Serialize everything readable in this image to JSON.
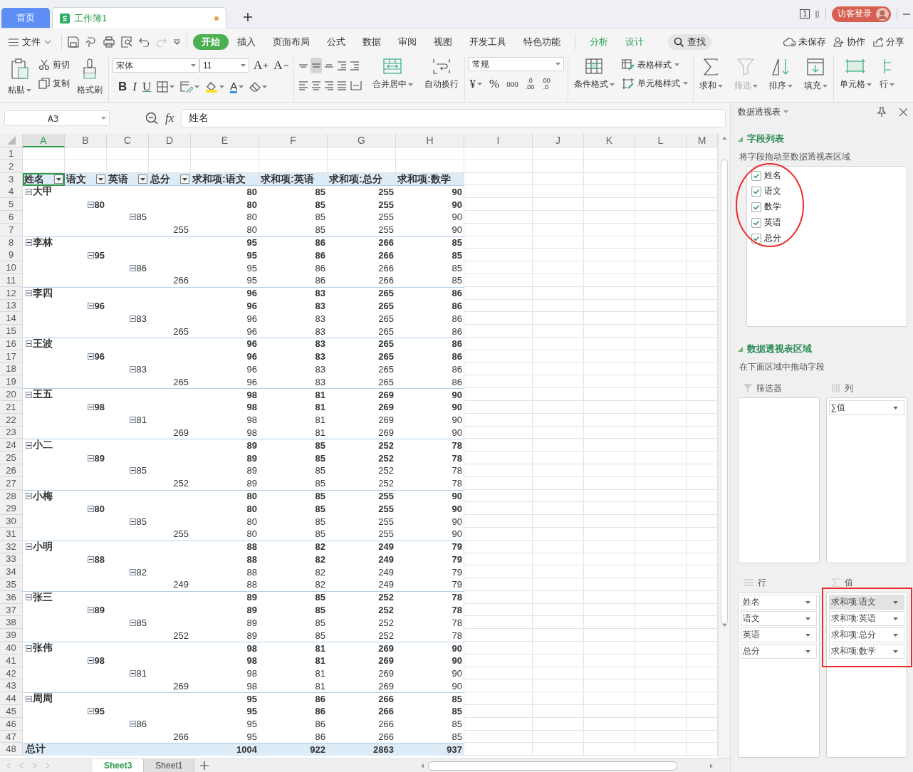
{
  "tabs": [
    {
      "label": "首页",
      "kind": "home",
      "selected": false
    },
    {
      "label": "工作簿1",
      "kind": "workbook",
      "selected": true,
      "unsaved": true
    }
  ],
  "title_bar": {
    "page_count": "1",
    "login_button": "访客登录"
  },
  "menu": {
    "file": "文件",
    "tabs": [
      {
        "label": "开始",
        "kind": "main",
        "selected": true
      },
      {
        "label": "插入",
        "kind": "main",
        "selected": false
      },
      {
        "label": "页面布局",
        "kind": "main",
        "selected": false
      },
      {
        "label": "公式",
        "kind": "main",
        "selected": false
      },
      {
        "label": "数据",
        "kind": "main",
        "selected": false
      },
      {
        "label": "审阅",
        "kind": "main",
        "selected": false
      },
      {
        "label": "视图",
        "kind": "main",
        "selected": false
      },
      {
        "label": "开发工具",
        "kind": "main",
        "selected": false
      },
      {
        "label": "特色功能",
        "kind": "main",
        "selected": false
      },
      {
        "label": "分析",
        "kind": "context",
        "selected": false
      },
      {
        "label": "设计",
        "kind": "context",
        "selected": false
      }
    ],
    "search": "查找",
    "actions": [
      "未保存",
      "协作",
      "分享"
    ]
  },
  "ribbon": {
    "paste": "粘贴",
    "cut": "剪切",
    "copy": "复制",
    "format_painter": "格式刷",
    "font_name": "宋体",
    "font_size": "11",
    "grow_font": "A",
    "shrink_font": "A",
    "bold": "B",
    "italic": "I",
    "underline": "U",
    "font_color": "A",
    "merge_center": "合并居中",
    "wrap_text": "自动换行",
    "number_format": "常规",
    "currency": "¥",
    "percent": "%",
    "thousands": "000",
    "increase_decimal": [
      ".0",
      ".00"
    ],
    "decrease_decimal": [
      ".00",
      ".0"
    ],
    "conditional_format": "条件格式",
    "table_style": "表格样式",
    "cell_style": "单元格样式",
    "sum": "求和",
    "filter": {
      "label": "筛选",
      "disabled": true
    },
    "sort": "排序",
    "fill": "填充",
    "cells": "单元格",
    "rows_columns": "行"
  },
  "formula_bar": {
    "name_box": "A3",
    "fx": "fx",
    "value": "姓名"
  },
  "sheet": {
    "columns": [
      {
        "label": "A",
        "selected": true
      },
      {
        "label": "B",
        "selected": false
      },
      {
        "label": "C",
        "selected": false
      },
      {
        "label": "D",
        "selected": false
      },
      {
        "label": "E",
        "selected": false
      },
      {
        "label": "F",
        "selected": false
      },
      {
        "label": "G",
        "selected": false
      },
      {
        "label": "H",
        "selected": false
      },
      {
        "label": "I",
        "selected": false
      },
      {
        "label": "J",
        "selected": false
      },
      {
        "label": "K",
        "selected": false
      },
      {
        "label": "L",
        "selected": false
      },
      {
        "label": "M",
        "selected": false
      }
    ],
    "row_numbers": [
      "1",
      "2",
      "3",
      "4",
      "5",
      "6",
      "7",
      "8",
      "9",
      "10",
      "11",
      "12",
      "13",
      "14",
      "15",
      "16",
      "17",
      "18",
      "19",
      "20",
      "21",
      "22",
      "23",
      "24",
      "25",
      "26",
      "27",
      "28",
      "29",
      "30",
      "31",
      "32",
      "33",
      "34",
      "35",
      "36",
      "37",
      "38",
      "39",
      "40",
      "41",
      "42",
      "43",
      "44",
      "45",
      "46",
      "47",
      "48"
    ],
    "header": [
      {
        "label": "姓名",
        "filter": true
      },
      {
        "label": "语文",
        "filter": true
      },
      {
        "label": "英语",
        "filter": true
      },
      {
        "label": "总分",
        "filter": true
      },
      {
        "label": "求和项:语文",
        "filter": false
      },
      {
        "label": "求和项:英语",
        "filter": false
      },
      {
        "label": "求和项:总分",
        "filter": false
      },
      {
        "label": "求和项:数学",
        "filter": false
      }
    ]
  },
  "pivot_rows": [
    {
      "kind": "name",
      "label": "大甲",
      "values": [
        "80",
        "85",
        "255",
        "90"
      ]
    },
    {
      "kind": "yuwen",
      "label": "80",
      "values": [
        "80",
        "85",
        "255",
        "90"
      ]
    },
    {
      "kind": "yingyu",
      "label": "85",
      "values": [
        "80",
        "85",
        "255",
        "90"
      ]
    },
    {
      "kind": "zongfen",
      "label": "255",
      "values": [
        "80",
        "85",
        "255",
        "90"
      ]
    },
    {
      "kind": "name",
      "label": "李林",
      "values": [
        "95",
        "86",
        "266",
        "85"
      ]
    },
    {
      "kind": "yuwen",
      "label": "95",
      "values": [
        "95",
        "86",
        "266",
        "85"
      ]
    },
    {
      "kind": "yingyu",
      "label": "86",
      "values": [
        "95",
        "86",
        "266",
        "85"
      ]
    },
    {
      "kind": "zongfen",
      "label": "266",
      "values": [
        "95",
        "86",
        "266",
        "85"
      ]
    },
    {
      "kind": "name",
      "label": "李四",
      "values": [
        "96",
        "83",
        "265",
        "86"
      ]
    },
    {
      "kind": "yuwen",
      "label": "96",
      "values": [
        "96",
        "83",
        "265",
        "86"
      ]
    },
    {
      "kind": "yingyu",
      "label": "83",
      "values": [
        "96",
        "83",
        "265",
        "86"
      ]
    },
    {
      "kind": "zongfen",
      "label": "265",
      "values": [
        "96",
        "83",
        "265",
        "86"
      ]
    },
    {
      "kind": "name",
      "label": "王波",
      "values": [
        "96",
        "83",
        "265",
        "86"
      ]
    },
    {
      "kind": "yuwen",
      "label": "96",
      "values": [
        "96",
        "83",
        "265",
        "86"
      ]
    },
    {
      "kind": "yingyu",
      "label": "83",
      "values": [
        "96",
        "83",
        "265",
        "86"
      ]
    },
    {
      "kind": "zongfen",
      "label": "265",
      "values": [
        "96",
        "83",
        "265",
        "86"
      ]
    },
    {
      "kind": "name",
      "label": "王五",
      "values": [
        "98",
        "81",
        "269",
        "90"
      ]
    },
    {
      "kind": "yuwen",
      "label": "98",
      "values": [
        "98",
        "81",
        "269",
        "90"
      ]
    },
    {
      "kind": "yingyu",
      "label": "81",
      "values": [
        "98",
        "81",
        "269",
        "90"
      ]
    },
    {
      "kind": "zongfen",
      "label": "269",
      "values": [
        "98",
        "81",
        "269",
        "90"
      ]
    },
    {
      "kind": "name",
      "label": "小二",
      "values": [
        "89",
        "85",
        "252",
        "78"
      ]
    },
    {
      "kind": "yuwen",
      "label": "89",
      "values": [
        "89",
        "85",
        "252",
        "78"
      ]
    },
    {
      "kind": "yingyu",
      "label": "85",
      "values": [
        "89",
        "85",
        "252",
        "78"
      ]
    },
    {
      "kind": "zongfen",
      "label": "252",
      "values": [
        "89",
        "85",
        "252",
        "78"
      ]
    },
    {
      "kind": "name",
      "label": "小梅",
      "values": [
        "80",
        "85",
        "255",
        "90"
      ]
    },
    {
      "kind": "yuwen",
      "label": "80",
      "values": [
        "80",
        "85",
        "255",
        "90"
      ]
    },
    {
      "kind": "yingyu",
      "label": "85",
      "values": [
        "80",
        "85",
        "255",
        "90"
      ]
    },
    {
      "kind": "zongfen",
      "label": "255",
      "values": [
        "80",
        "85",
        "255",
        "90"
      ]
    },
    {
      "kind": "name",
      "label": "小明",
      "values": [
        "88",
        "82",
        "249",
        "79"
      ]
    },
    {
      "kind": "yuwen",
      "label": "88",
      "values": [
        "88",
        "82",
        "249",
        "79"
      ]
    },
    {
      "kind": "yingyu",
      "label": "82",
      "values": [
        "88",
        "82",
        "249",
        "79"
      ]
    },
    {
      "kind": "zongfen",
      "label": "249",
      "values": [
        "88",
        "82",
        "249",
        "79"
      ]
    },
    {
      "kind": "name",
      "label": "张三",
      "values": [
        "89",
        "85",
        "252",
        "78"
      ]
    },
    {
      "kind": "yuwen",
      "label": "89",
      "values": [
        "89",
        "85",
        "252",
        "78"
      ]
    },
    {
      "kind": "yingyu",
      "label": "85",
      "values": [
        "89",
        "85",
        "252",
        "78"
      ]
    },
    {
      "kind": "zongfen",
      "label": "252",
      "values": [
        "89",
        "85",
        "252",
        "78"
      ]
    },
    {
      "kind": "name",
      "label": "张伟",
      "values": [
        "98",
        "81",
        "269",
        "90"
      ]
    },
    {
      "kind": "yuwen",
      "label": "98",
      "values": [
        "98",
        "81",
        "269",
        "90"
      ]
    },
    {
      "kind": "yingyu",
      "label": "81",
      "values": [
        "98",
        "81",
        "269",
        "90"
      ]
    },
    {
      "kind": "zongfen",
      "label": "269",
      "values": [
        "98",
        "81",
        "269",
        "90"
      ]
    },
    {
      "kind": "name",
      "label": "周周",
      "values": [
        "95",
        "86",
        "266",
        "85"
      ]
    },
    {
      "kind": "yuwen",
      "label": "95",
      "values": [
        "95",
        "86",
        "266",
        "85"
      ]
    },
    {
      "kind": "yingyu",
      "label": "86",
      "values": [
        "95",
        "86",
        "266",
        "85"
      ]
    },
    {
      "kind": "zongfen",
      "label": "266",
      "values": [
        "95",
        "86",
        "266",
        "85"
      ]
    },
    {
      "kind": "total",
      "label": "总计",
      "values": [
        "1004",
        "922",
        "2863",
        "937"
      ]
    }
  ],
  "sheet_tabs": [
    {
      "label": "Sheet3",
      "selected": true
    },
    {
      "label": "Sheet1",
      "selected": false
    }
  ],
  "pivot_panel": {
    "title": "数据透视表",
    "field_section": "字段列表",
    "field_hint": "将字段拖动至数据透视表区域",
    "fields": [
      {
        "label": "姓名",
        "checked": true
      },
      {
        "label": "语文",
        "checked": true
      },
      {
        "label": "数学",
        "checked": true
      },
      {
        "label": "英语",
        "checked": true
      },
      {
        "label": "总分",
        "checked": true
      }
    ],
    "area_section": "数据透视表区域",
    "area_hint": "在下面区域中拖动字段",
    "filters": {
      "label": "筛选器"
    },
    "columns": {
      "label": "列",
      "items": [
        {
          "label": "∑值",
          "selected": false
        }
      ]
    },
    "rows": {
      "label": "行",
      "items": [
        {
          "label": "姓名",
          "selected": false
        },
        {
          "label": "语文",
          "selected": false
        },
        {
          "label": "英语",
          "selected": false
        },
        {
          "label": "总分",
          "selected": false
        }
      ]
    },
    "values": {
      "label": "值",
      "items": [
        {
          "label": "求和项:语文",
          "selected": true
        },
        {
          "label": "求和项:英语",
          "selected": false
        },
        {
          "label": "求和项:总分",
          "selected": false
        },
        {
          "label": "求和项:数学",
          "selected": false
        }
      ]
    }
  }
}
